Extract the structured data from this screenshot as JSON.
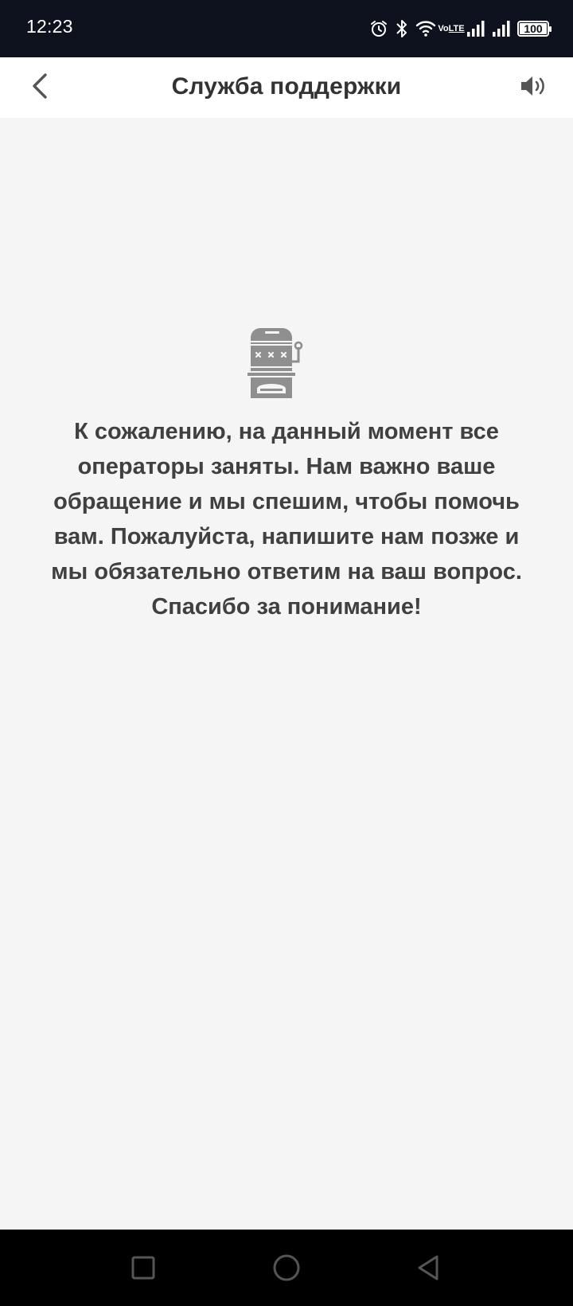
{
  "status_bar": {
    "time": "12:23",
    "icons": [
      "alarm-icon",
      "bluetooth-icon",
      "wifi-icon",
      "volte-icon",
      "signal-icon",
      "signal-icon",
      "battery-icon"
    ],
    "volte_line1": "Vo",
    "volte_line2": "LTE",
    "battery_level": "100"
  },
  "app_bar": {
    "title": "Служба поддержки",
    "back_icon": "chevron-left-icon",
    "sound_icon": "speaker-icon"
  },
  "main": {
    "illustration_icon": "slot-machine-icon",
    "message": "К сожалению, на данный момент все операторы заняты. Нам важно ваше обращение и мы спешим, чтобы помочь вам. Пожалуйста, напишите нам позже и мы обязательно ответим на ваш вопрос. Спасибо за понимание!"
  },
  "nav_bar": {
    "icons": [
      "square-recents-icon",
      "circle-home-icon",
      "triangle-back-icon"
    ]
  },
  "colors": {
    "status_bar_bg": "#0e121e",
    "app_bar_bg": "#ffffff",
    "content_bg": "#f5f5f5",
    "text": "#404040",
    "illustration": "#8f8f8f",
    "nav_bar_bg": "#000000"
  }
}
